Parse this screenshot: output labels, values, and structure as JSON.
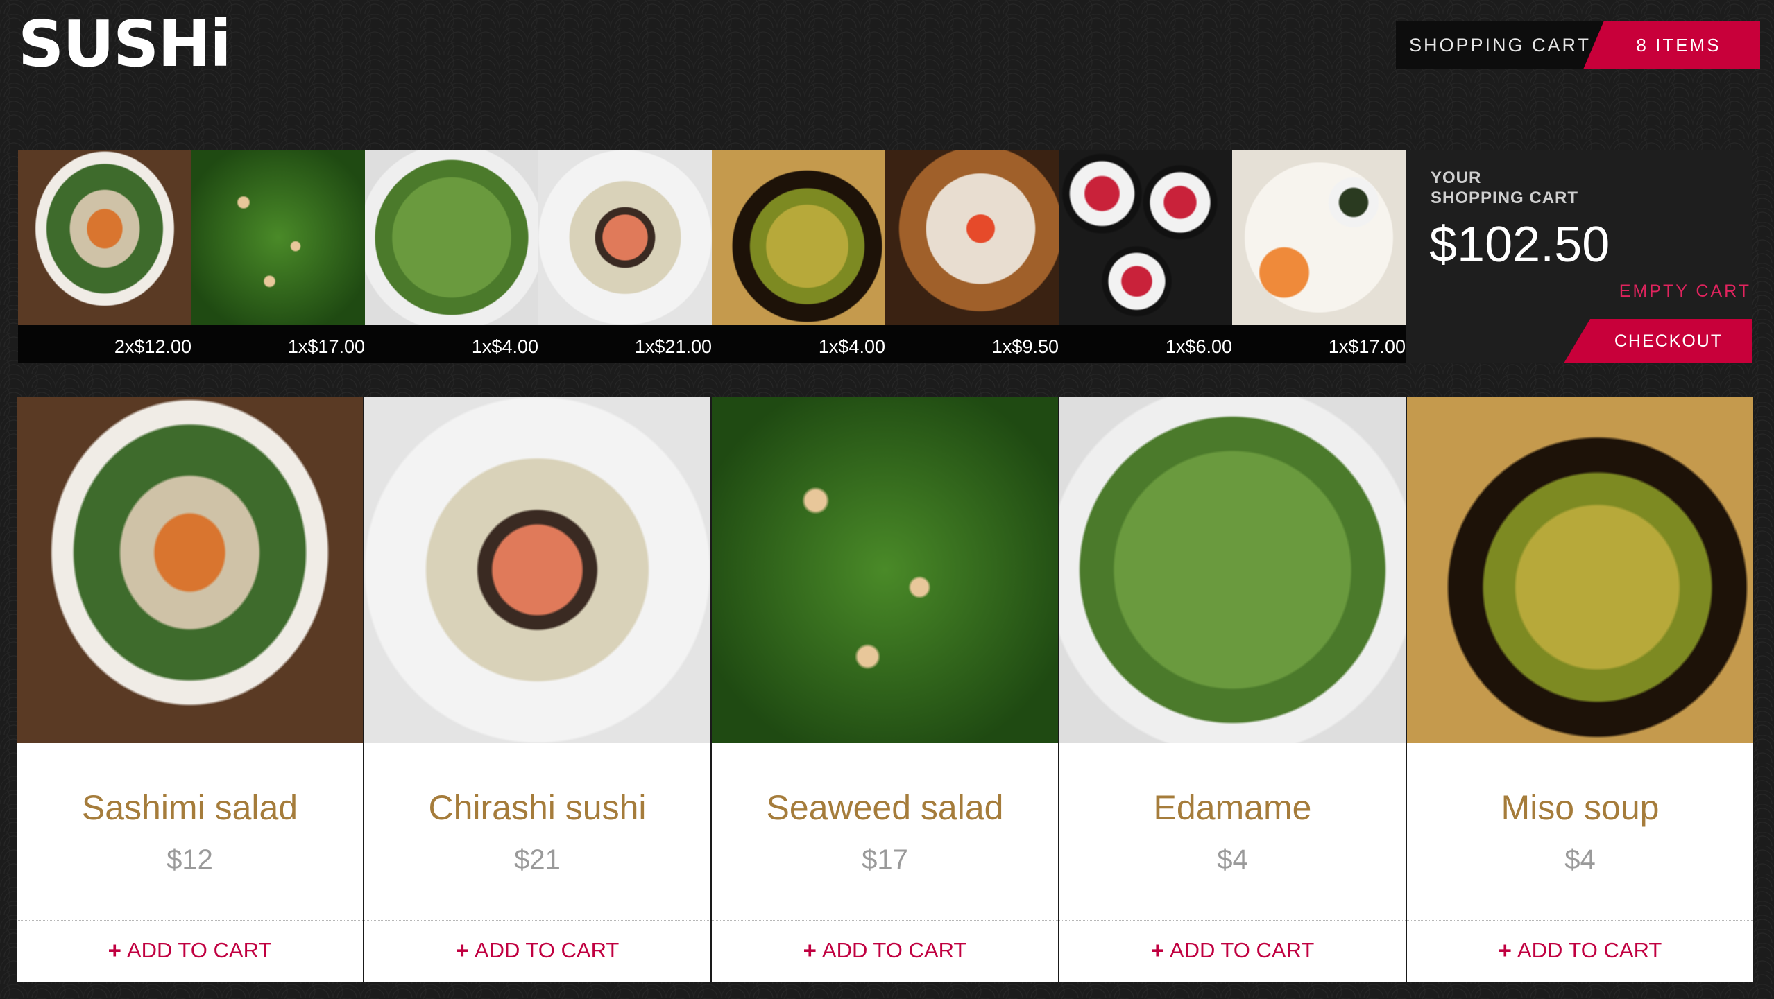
{
  "header": {
    "logo_text": "SUSHi",
    "cart_label": "SHOPPING CART",
    "cart_count": "8 ITEMS"
  },
  "colors": {
    "accent": "#c8003a",
    "product_name": "#a57c3b",
    "price": "#9a9a9a",
    "background": "#1c1c1c"
  },
  "cart_strip": {
    "items": [
      {
        "photo": "sashimi-salad-photo",
        "qty_price": "2x$12.00"
      },
      {
        "photo": "seaweed-salad-photo",
        "qty_price": "1x$17.00"
      },
      {
        "photo": "edamame-photo",
        "qty_price": "1x$4.00"
      },
      {
        "photo": "chirashi-sushi-photo",
        "qty_price": "1x$21.00"
      },
      {
        "photo": "miso-soup-photo",
        "qty_price": "1x$4.00"
      },
      {
        "photo": "nigiri-photo",
        "qty_price": "1x$9.50"
      },
      {
        "photo": "maki-rolls-photo",
        "qty_price": "1x$6.00"
      },
      {
        "photo": "sushi-platter-photo",
        "qty_price": "1x$17.00"
      }
    ],
    "summary": {
      "title_line1": "YOUR",
      "title_line2": "SHOPPING CART",
      "total": "$102.50",
      "empty_label": "EMPTY CART",
      "checkout_label": "CHECKOUT"
    }
  },
  "products": [
    {
      "name": "Sashimi salad",
      "price": "$12",
      "add_label": "ADD TO CART",
      "add_icon": "plus-icon",
      "photo": "sashimi-salad-photo"
    },
    {
      "name": "Chirashi sushi",
      "price": "$21",
      "add_label": "ADD TO CART",
      "add_icon": "plus-icon",
      "photo": "chirashi-sushi-photo"
    },
    {
      "name": "Seaweed salad",
      "price": "$17",
      "add_label": "ADD TO CART",
      "add_icon": "plus-icon",
      "photo": "seaweed-salad-photo"
    },
    {
      "name": "Edamame",
      "price": "$4",
      "add_label": "ADD TO CART",
      "add_icon": "plus-icon",
      "photo": "edamame-photo"
    },
    {
      "name": "Miso soup",
      "price": "$4",
      "add_label": "ADD TO CART",
      "add_icon": "plus-icon",
      "photo": "miso-soup-photo"
    }
  ]
}
